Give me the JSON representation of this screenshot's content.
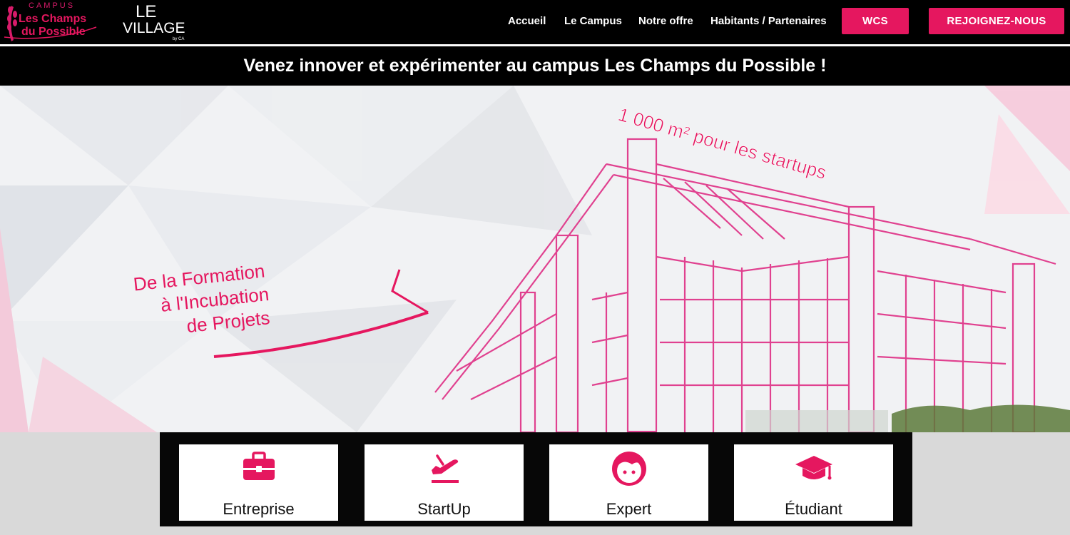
{
  "header": {
    "logo_campus": {
      "line1": "CAMPUS",
      "line2": "Les Champs",
      "line3": "du Possible"
    },
    "logo_village": {
      "line1": "LE",
      "line2": "VILLAGE",
      "by": "by CA"
    },
    "nav": [
      {
        "label": "Accueil"
      },
      {
        "label": "Le Campus"
      },
      {
        "label": "Notre offre"
      },
      {
        "label": "Habitants / Partenaires"
      }
    ],
    "wcs_label": "WCS",
    "join_label": "REJOIGNEZ-NOUS"
  },
  "tagline": "Venez innover et expérimenter au campus Les Champs du Possible !",
  "hero": {
    "banner_text": "1 000 m² pour les startups",
    "caption": [
      "De la Formation",
      "à l'Incubation",
      "de Projets"
    ]
  },
  "cards": [
    {
      "label": "Entreprise",
      "icon": "briefcase-icon"
    },
    {
      "label": "StartUp",
      "icon": "plane-departure-icon"
    },
    {
      "label": "Expert",
      "icon": "face-icon"
    },
    {
      "label": "Étudiant",
      "icon": "graduation-cap-icon"
    }
  ],
  "colors": {
    "accent": "#e5175f",
    "header_bg": "#000000"
  }
}
